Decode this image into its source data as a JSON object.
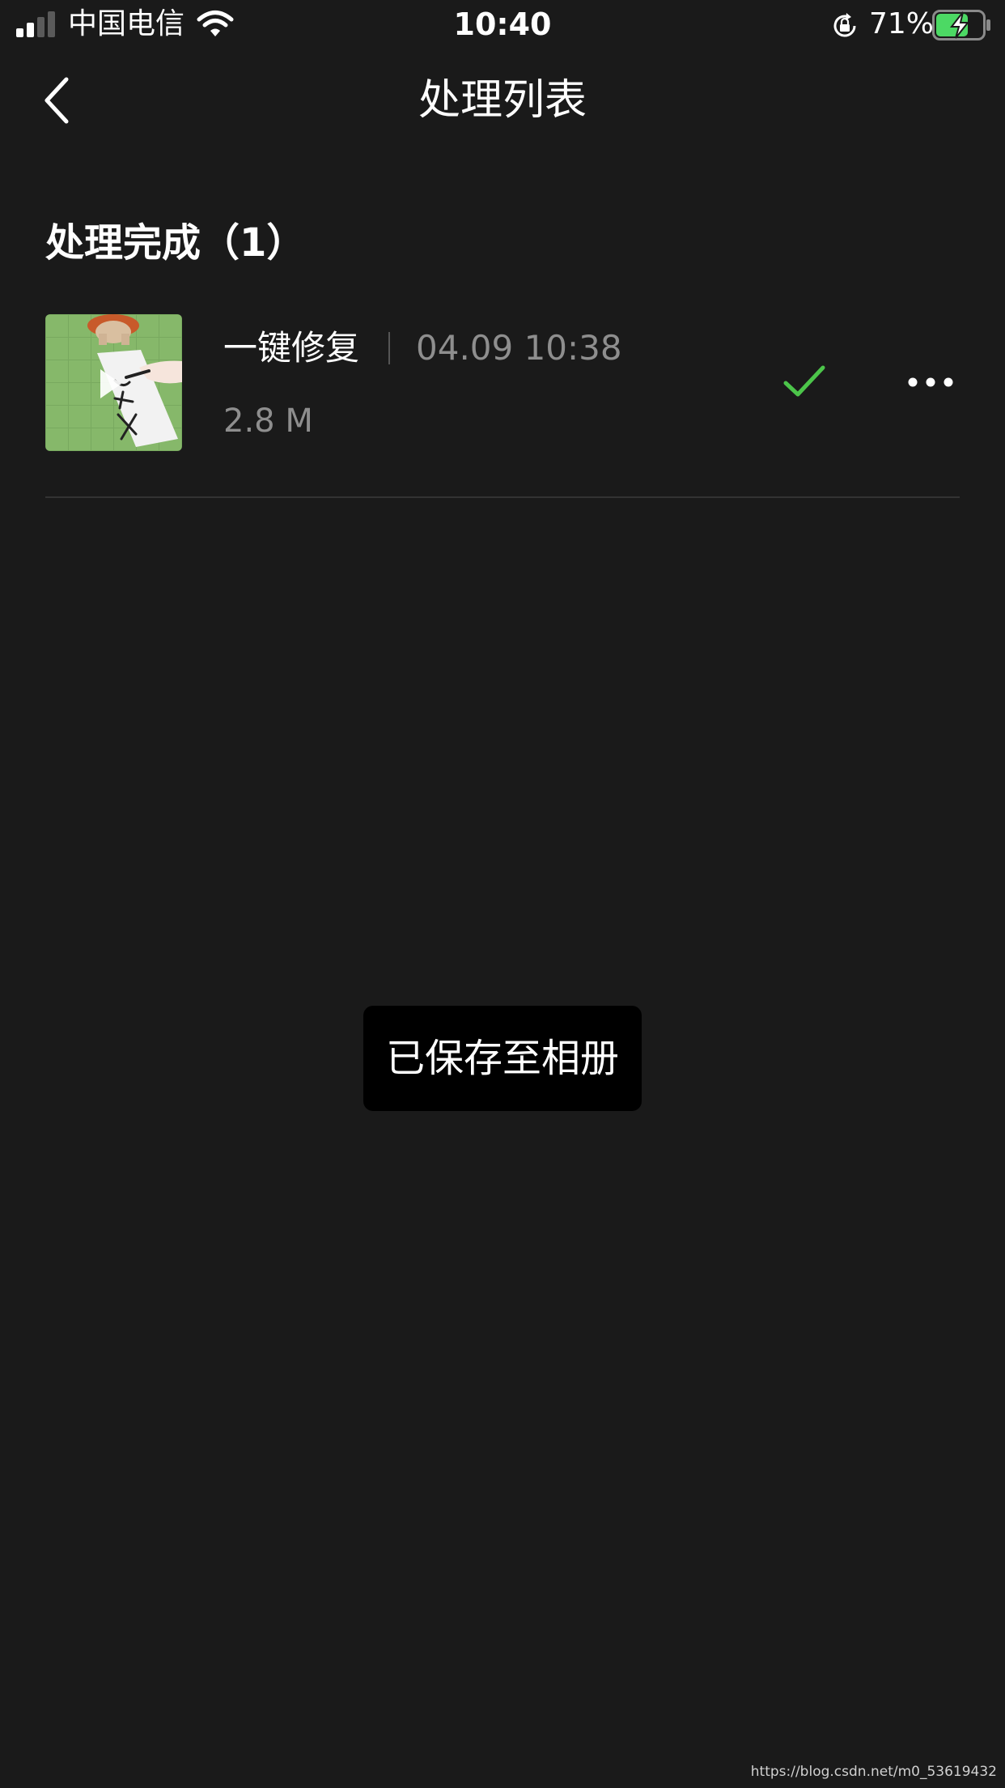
{
  "status_bar": {
    "carrier": "中国电信",
    "time": "10:40",
    "battery_percent": "71%",
    "signal_bars": 2,
    "signal_total": 4,
    "battery_level": 0.71,
    "charging": true,
    "icons": [
      "signal-icon",
      "wifi-icon",
      "rotation-lock-icon",
      "battery-charging-icon"
    ]
  },
  "nav": {
    "title": "处理列表",
    "back_icon": "chevron-left-icon"
  },
  "section": {
    "title": "处理完成（1）"
  },
  "items": [
    {
      "name": "一键修复",
      "time": "04.09 10:38",
      "size": "2.8 M",
      "status_icon": "check-icon",
      "more_icon": "more-horizontal-icon",
      "thumbnail_icon": "video-thumbnail"
    }
  ],
  "toast": {
    "text": "已保存至相册"
  },
  "watermark": "https://blog.csdn.net/m0_53619432",
  "colors": {
    "background": "#1a1a1a",
    "text_primary": "#ffffff",
    "text_secondary": "#8e8e8e",
    "check_green": "#4cc54a",
    "battery_green": "#4cd964",
    "toast_bg": "#000000",
    "divider": "#333333"
  }
}
